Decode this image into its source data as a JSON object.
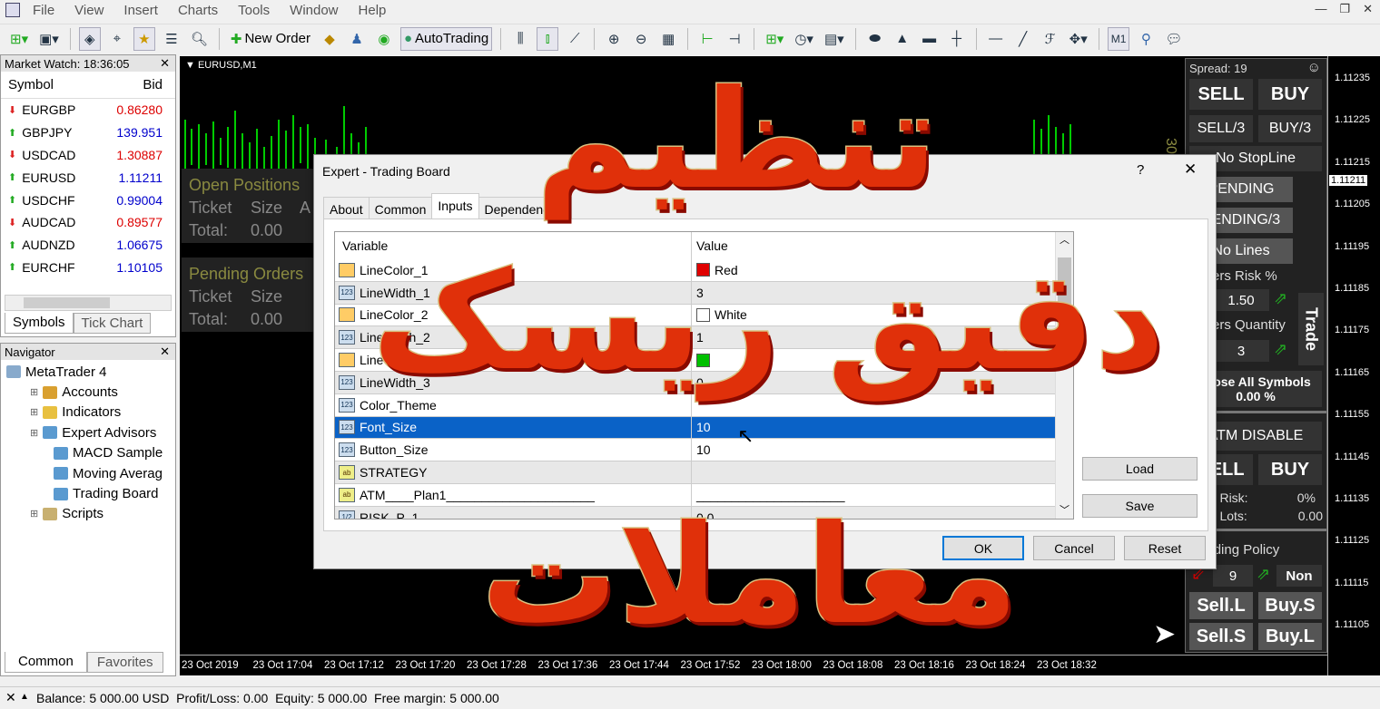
{
  "menu": [
    "File",
    "View",
    "Insert",
    "Charts",
    "Tools",
    "Window",
    "Help"
  ],
  "toolbar": {
    "new_order": "New Order",
    "autotrading": "AutoTrading",
    "timeframe": "M1"
  },
  "market_watch": {
    "title": "Market Watch: 18:36:05",
    "col_symbol": "Symbol",
    "col_bid": "Bid",
    "rows": [
      {
        "symbol": "EURGBP",
        "bid": "0.86280",
        "dir": "down"
      },
      {
        "symbol": "GBPJPY",
        "bid": "139.951",
        "dir": "up"
      },
      {
        "symbol": "USDCAD",
        "bid": "1.30887",
        "dir": "down"
      },
      {
        "symbol": "EURUSD",
        "bid": "1.11211",
        "dir": "up"
      },
      {
        "symbol": "USDCHF",
        "bid": "0.99004",
        "dir": "up"
      },
      {
        "symbol": "AUDCAD",
        "bid": "0.89577",
        "dir": "down"
      },
      {
        "symbol": "AUDNZD",
        "bid": "1.06675",
        "dir": "up"
      },
      {
        "symbol": "EURCHF",
        "bid": "1.10105",
        "dir": "up"
      }
    ],
    "tabs": [
      "Symbols",
      "Tick Chart"
    ]
  },
  "navigator": {
    "title": "Navigator",
    "items": [
      {
        "label": "MetaTrader 4",
        "level": 0
      },
      {
        "label": "Accounts",
        "level": 1
      },
      {
        "label": "Indicators",
        "level": 1
      },
      {
        "label": "Expert Advisors",
        "level": 1
      },
      {
        "label": "MACD Sample",
        "level": 2
      },
      {
        "label": "Moving Averag",
        "level": 2
      },
      {
        "label": "Trading Board",
        "level": 2
      },
      {
        "label": "Scripts",
        "level": 1
      }
    ],
    "tabs": [
      "Common",
      "Favorites"
    ]
  },
  "chart": {
    "symbol": "EURUSD,M1",
    "open_positions": "Open Positions",
    "pending_orders": "Pending Orders",
    "ticket": "Ticket",
    "size": "Size",
    "a": "A",
    "total": "Total:",
    "total_value": "0.00",
    "side_label": "30",
    "prices": [
      "1.11235",
      "1.11225",
      "1.11215",
      "1.11205",
      "1.11195",
      "1.11185",
      "1.11175",
      "1.11165",
      "1.11155",
      "1.11145",
      "1.11135",
      "1.11125",
      "1.11115",
      "1.11105"
    ],
    "current_price": "1.11211",
    "times": [
      "23 Oct 2019",
      "23 Oct 17:04",
      "23 Oct 17:12",
      "23 Oct 17:20",
      "23 Oct 17:28",
      "23 Oct 17:36",
      "23 Oct 17:44",
      "23 Oct 17:52",
      "23 Oct 18:00",
      "23 Oct 18:08",
      "23 Oct 18:16",
      "23 Oct 18:24",
      "23 Oct 18:32"
    ]
  },
  "trade_panel": {
    "spread": "Spread: 19",
    "sell": "SELL",
    "buy": "BUY",
    "sell3": "SELL/3",
    "buy3": "BUY/3",
    "no_stopline": "No StopLine",
    "pending": "PENDING",
    "pending3": "PENDING/3",
    "no_lines": "No Lines",
    "risk_label": "Orders Risk %",
    "risk_value": "1.50",
    "qty_label": "Orders Quantity",
    "qty_value": "3",
    "trade": "Trade",
    "close_all": "Close All Symbols",
    "close_pct": "0.00 %",
    "atm": "ATM DISABLE",
    "sell2": "SELL",
    "buy2": "BUY",
    "total_risk": "Total Risk:",
    "total_risk_value": "0%",
    "total_lots": "Total Lots:",
    "total_lots_value": "0.00",
    "pending_policy": "Pending Policy",
    "policy_value": "9",
    "policy_mode": "Non",
    "sell_l": "Sell.L",
    "buy_s": "Buy.S",
    "sell_s": "Sell.S",
    "buy_l": "Buy.L"
  },
  "dialog": {
    "title": "Expert - Trading Board",
    "help": "?",
    "close": "✕",
    "tabs": [
      "About",
      "Common",
      "Inputs",
      "Dependencies"
    ],
    "active_tab": "Inputs",
    "col_variable": "Variable",
    "col_value": "Value",
    "rows": [
      {
        "type": "color",
        "name": "LineColor_1",
        "value": "Red",
        "swatch": "#e00000"
      },
      {
        "type": "int",
        "name": "LineWidth_1",
        "value": "3"
      },
      {
        "type": "color",
        "name": "LineColor_2",
        "value": "White",
        "swatch": "#ffffff"
      },
      {
        "type": "int",
        "name": "LineWidth_2",
        "value": "1"
      },
      {
        "type": "color",
        "name": "LineColor_3",
        "value": "",
        "swatch": "#00c000"
      },
      {
        "type": "int",
        "name": "LineWidth_3",
        "value": "0"
      },
      {
        "type": "int",
        "name": "Color_Theme",
        "value": ""
      },
      {
        "type": "int",
        "name": "Font_Size",
        "value": "10",
        "selected": true
      },
      {
        "type": "int",
        "name": "Button_Size",
        "value": "10"
      },
      {
        "type": "str",
        "name": "STRATEGY",
        "value": ""
      },
      {
        "type": "str",
        "name": "ATM____Plan1_____________________",
        "value": "_____________________"
      },
      {
        "type": "dbl",
        "name": "RISK_P_1",
        "value": "0.0"
      }
    ],
    "load": "Load",
    "save": "Save",
    "ok": "OK",
    "cancel": "Cancel",
    "reset": "Reset"
  },
  "overlay_text": {
    "line1": "تنظیم",
    "line2": "دقیق ریسک",
    "line3": "معاملات"
  },
  "status": {
    "balance": "Balance: 5 000.00 USD",
    "pl": "Profit/Loss: 0.00",
    "equity": "Equity: 5 000.00",
    "free_margin": "Free margin: 5 000.00"
  }
}
